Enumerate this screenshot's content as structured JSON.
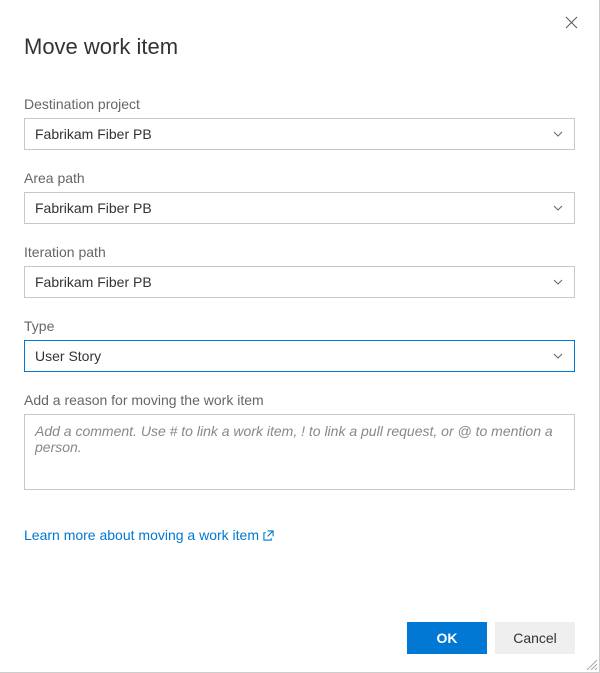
{
  "dialog": {
    "title": "Move work item"
  },
  "fields": {
    "destination": {
      "label": "Destination project",
      "value": "Fabrikam Fiber PB"
    },
    "area": {
      "label": "Area path",
      "value": "Fabrikam Fiber PB"
    },
    "iteration": {
      "label": "Iteration path",
      "value": "Fabrikam Fiber PB"
    },
    "type": {
      "label": "Type",
      "value": "User Story"
    },
    "reason": {
      "label": "Add a reason for moving the work item",
      "placeholder": "Add a comment. Use # to link a work item, ! to link a pull request, or @ to mention a person."
    }
  },
  "link": {
    "learn_more": "Learn more about moving a work item"
  },
  "buttons": {
    "ok": "OK",
    "cancel": "Cancel"
  }
}
